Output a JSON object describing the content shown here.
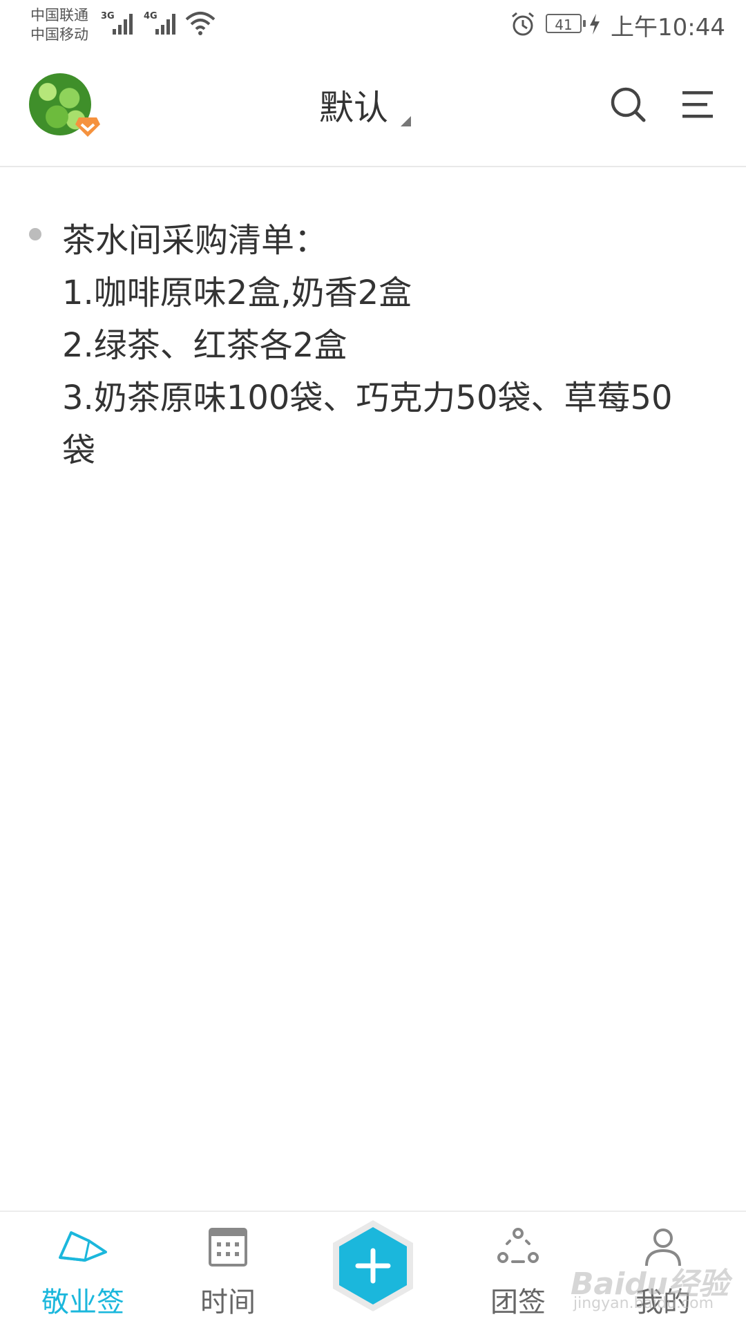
{
  "status": {
    "carrier1": "中国联通",
    "carrier2": "中国移动",
    "net1": "3G",
    "net2": "4G",
    "battery": "41",
    "time": "上午10:44"
  },
  "header": {
    "title": "默认"
  },
  "note": {
    "lines": [
      "茶水间采购清单：",
      "1.咖啡原味2盒,奶香2盒",
      "2.绿茶、红茶各2盒",
      "3.奶茶原味100袋、巧克力50袋、草莓50袋"
    ]
  },
  "nav": {
    "tabs": [
      {
        "label": "敬业签",
        "icon": "home-note-icon"
      },
      {
        "label": "时间",
        "icon": "calendar-icon"
      },
      {
        "label": "",
        "icon": "add-icon"
      },
      {
        "label": "团签",
        "icon": "group-icon"
      },
      {
        "label": "我的",
        "icon": "user-icon"
      }
    ]
  },
  "colors": {
    "accent": "#1bb7dc",
    "text": "#333333",
    "muted": "#666666"
  },
  "watermark": {
    "brand": "Baidu经验",
    "url": "jingyan.baidu.com"
  }
}
